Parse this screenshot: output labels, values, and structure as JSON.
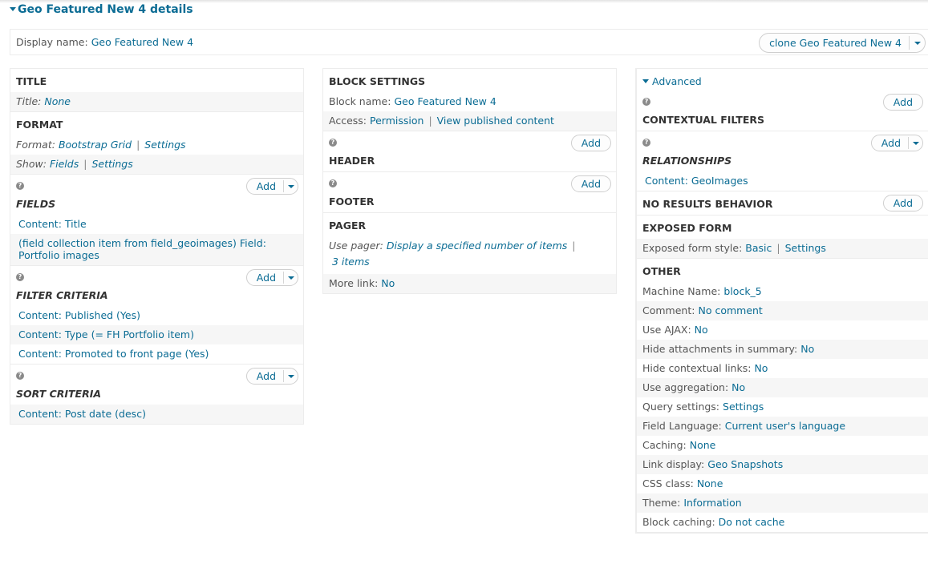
{
  "header": {
    "title": "Geo Featured New 4 details",
    "display_name_label": "Display name:",
    "display_name_value": "Geo Featured New 4",
    "clone_button": "clone Geo Featured New 4"
  },
  "colors": {
    "link": "#0b6c94",
    "text": "#555555",
    "heading": "#333333",
    "alt_row": "#f6f6f6",
    "border": "#ececec"
  },
  "col1": {
    "title": {
      "heading": "TITLE",
      "label": "Title:",
      "value": "None"
    },
    "format": {
      "heading": "FORMAT",
      "format_label": "Format:",
      "format_value": "Bootstrap Grid",
      "format_settings": "Settings",
      "show_label": "Show:",
      "show_value": "Fields",
      "show_settings": "Settings"
    },
    "fields": {
      "heading": "FIELDS",
      "add": "Add",
      "items": [
        "Content: Title",
        "(field collection item from field_geoimages) Field: Portfolio images"
      ]
    },
    "filter_criteria": {
      "heading": "FILTER CRITERIA",
      "add": "Add",
      "items": [
        "Content: Published (Yes)",
        "Content: Type (= FH Portfolio item)",
        "Content: Promoted to front page (Yes)"
      ]
    },
    "sort_criteria": {
      "heading": "SORT CRITERIA",
      "add": "Add",
      "items": [
        "Content: Post date (desc)"
      ]
    }
  },
  "col2": {
    "block_settings": {
      "heading": "BLOCK SETTINGS",
      "block_name_label": "Block name:",
      "block_name_value": "Geo Featured New 4",
      "access_label": "Access:",
      "access_value": "Permission",
      "access_detail": "View published content"
    },
    "header": {
      "heading": "HEADER",
      "add": "Add"
    },
    "footer": {
      "heading": "FOOTER",
      "add": "Add"
    },
    "pager": {
      "heading": "PAGER",
      "use_pager_label": "Use pager:",
      "use_pager_value": "Display a specified number of items",
      "items_value": "3 items",
      "more_link_label": "More link:",
      "more_link_value": "No"
    }
  },
  "col3": {
    "advanced_label": "Advanced",
    "contextual_filters": {
      "heading": "CONTEXTUAL FILTERS",
      "add": "Add"
    },
    "relationships": {
      "heading": "RELATIONSHIPS",
      "add": "Add",
      "items": [
        "Content: GeoImages"
      ]
    },
    "no_results": {
      "heading": "NO RESULTS BEHAVIOR",
      "add": "Add"
    },
    "exposed_form": {
      "heading": "EXPOSED FORM",
      "style_label": "Exposed form style:",
      "style_value": "Basic",
      "style_settings": "Settings"
    },
    "other": {
      "heading": "OTHER",
      "rows": [
        {
          "label": "Machine Name:",
          "value": "block_5"
        },
        {
          "label": "Comment:",
          "value": "No comment"
        },
        {
          "label": "Use AJAX:",
          "value": "No"
        },
        {
          "label": "Hide attachments in summary:",
          "value": "No"
        },
        {
          "label": "Hide contextual links:",
          "value": "No"
        },
        {
          "label": "Use aggregation:",
          "value": "No"
        },
        {
          "label": "Query settings:",
          "value": "Settings"
        },
        {
          "label": "Field Language:",
          "value": "Current user's language"
        },
        {
          "label": "Caching:",
          "value": "None"
        },
        {
          "label": "Link display:",
          "value": "Geo Snapshots"
        },
        {
          "label": "CSS class:",
          "value": "None"
        },
        {
          "label": "Theme:",
          "value": "Information"
        },
        {
          "label": "Block caching:",
          "value": "Do not cache"
        }
      ]
    }
  }
}
